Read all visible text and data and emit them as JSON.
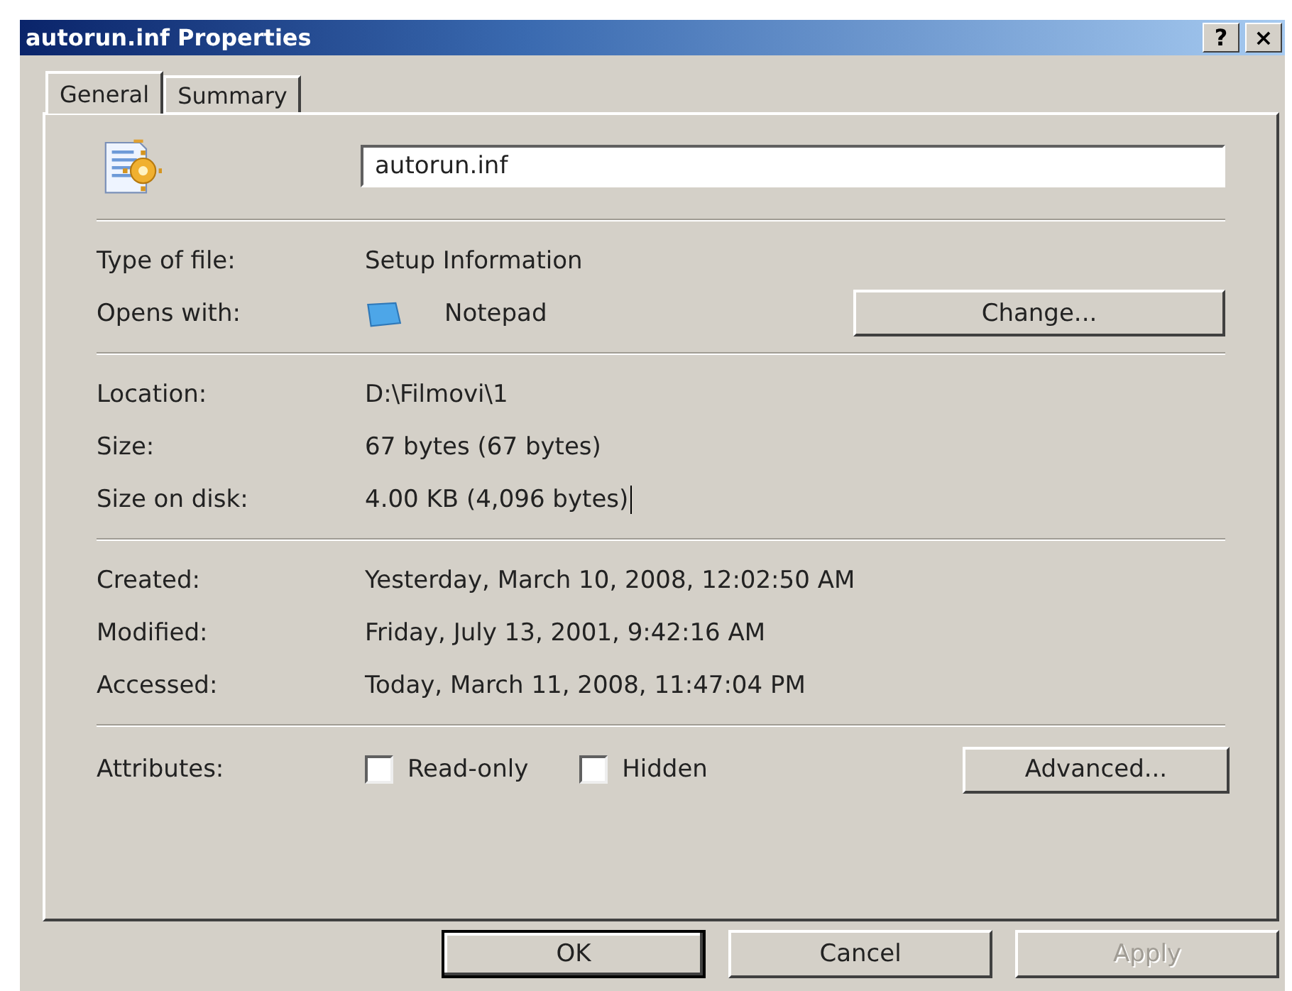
{
  "window": {
    "title": "autorun.inf Properties",
    "title_buttons": [
      {
        "label": "?"
      },
      {
        "label": "×"
      }
    ]
  },
  "tabs": [
    {
      "label": "General",
      "selected": true
    },
    {
      "label": "Summary",
      "selected": false
    }
  ],
  "file_name": {
    "value": "autorun.inf"
  },
  "sections": [
    [
      {
        "kind": "text",
        "label": "Type of file:",
        "value": "Setup Information"
      },
      {
        "kind": "app",
        "label": "Opens with:",
        "value": "Notepad",
        "button": "Change..."
      }
    ],
    [
      {
        "kind": "text",
        "label": "Location:",
        "value": "D:\\Filmovi\\1"
      },
      {
        "kind": "text",
        "label": "Size:",
        "value": "67 bytes (67 bytes)"
      },
      {
        "kind": "text",
        "label": "Size on disk:",
        "value": "4.00 KB (4,096 bytes)",
        "cursor": true
      }
    ],
    [
      {
        "kind": "text",
        "label": "Created:",
        "value": "Yesterday, March 10, 2008, 12:02:50 AM"
      },
      {
        "kind": "text",
        "label": "Modified:",
        "value": "Friday, July 13, 2001, 9:42:16 AM"
      },
      {
        "kind": "text",
        "label": "Accessed:",
        "value": "Today, March 11, 2008, 11:47:04 PM"
      }
    ]
  ],
  "attributes": {
    "label": "Attributes:",
    "checkboxes": [
      {
        "label": "Read-only",
        "checked": false
      },
      {
        "label": "Hidden",
        "checked": false
      }
    ],
    "button": "Advanced..."
  },
  "buttons": [
    {
      "label": "OK",
      "default": true,
      "disabled": false
    },
    {
      "label": "Cancel",
      "default": false,
      "disabled": false
    },
    {
      "label": "Apply",
      "default": false,
      "disabled": true
    }
  ]
}
